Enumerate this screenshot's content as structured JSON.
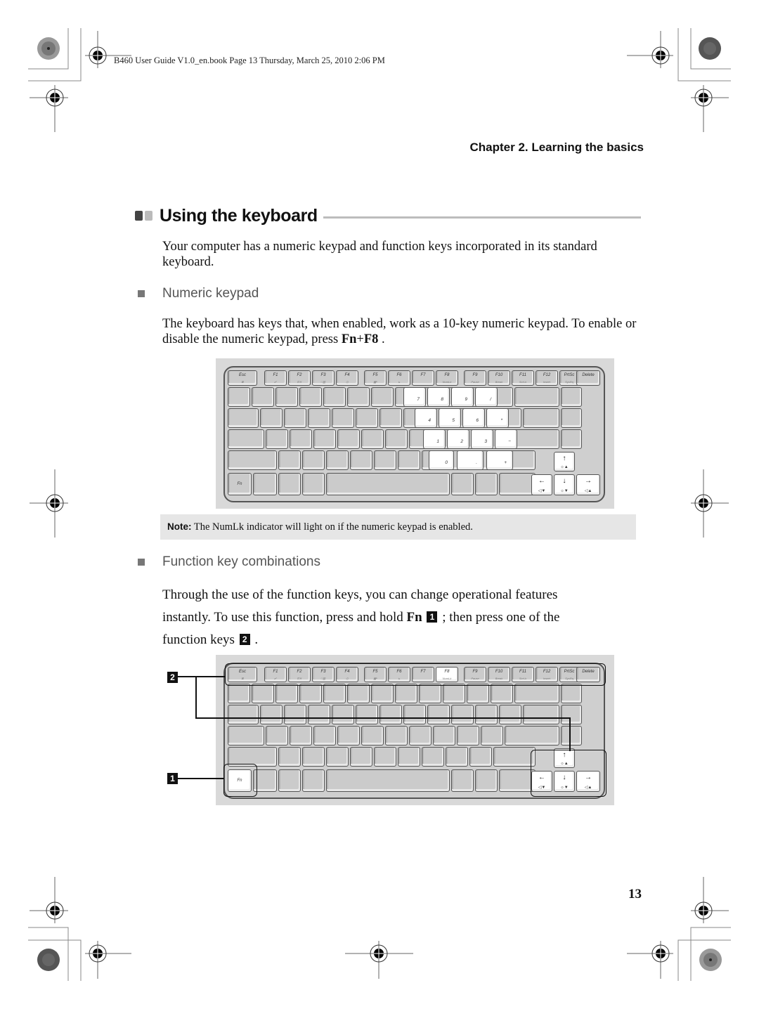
{
  "print_header": "B460 User Guide V1.0_en.book  Page 13  Thursday, March 25, 2010  2:06 PM",
  "chapter_title": "Chapter 2. Learning the basics",
  "section": {
    "title": "Using the keyboard",
    "intro": "Your computer has a numeric keypad and function keys incorporated in its standard keyboard."
  },
  "numeric_keypad": {
    "heading": "Numeric keypad",
    "text_before": "The keyboard has keys that, when enabled, work as a 10-key numeric keypad. To enable or disable the numeric keypad, press ",
    "key_fn": "Fn",
    "plus": "+",
    "key_f8": "F8",
    "text_after": " ."
  },
  "note": {
    "label": "Note:",
    "text": " The NumLk indicator will light on if the numeric keypad is enabled."
  },
  "function_keys": {
    "heading": "Function key combinations",
    "line1": "Through the use of the function keys, you can change operational features",
    "line2_a": "instantly. To use this function, press and hold ",
    "key_fn": "Fn",
    "callout1": "1",
    "line2_b": " ; then press one of the",
    "line3_a": "function keys ",
    "callout2": "2",
    "line3_b": " ."
  },
  "keyboard": {
    "function_row": [
      {
        "label": "Esc",
        "sub": "⊠"
      },
      {
        "label": "F1",
        "sub": "zᶻ"
      },
      {
        "label": "F2",
        "sub": "⊡✕"
      },
      {
        "label": "F3",
        "sub": "□▥"
      },
      {
        "label": "F4",
        "sub": "⎙"
      },
      {
        "label": "F5",
        "sub": "▦ᵃ"
      },
      {
        "label": "F6",
        "sub": "⊾"
      },
      {
        "label": "F7",
        "sub": ""
      },
      {
        "label": "F8",
        "sub": "NumLk"
      },
      {
        "label": "F9",
        "sub": "Pause"
      },
      {
        "label": "F10",
        "sub": "Break"
      },
      {
        "label": "F11",
        "sub": "ScrLk"
      },
      {
        "label": "F12",
        "sub": "Insert"
      },
      {
        "label": "PrtSc",
        "sub": "SysRq"
      },
      {
        "label": "Delete",
        "sub": ""
      }
    ],
    "numpad_keys": [
      "7",
      "8",
      "9",
      "/",
      "4",
      "5",
      "6",
      "*",
      "1",
      "2",
      "3",
      "−",
      "0",
      ".",
      "+"
    ],
    "fn_label": "Fn",
    "arrows": {
      "up": {
        "glyph": "↑",
        "sub": "☼▲"
      },
      "left": {
        "glyph": "←",
        "sub": "◁▼"
      },
      "down": {
        "glyph": "↓",
        "sub": "☼▼"
      },
      "right": {
        "glyph": "→",
        "sub": "◁▲"
      }
    },
    "callouts": [
      "2",
      "1"
    ]
  },
  "page_number": "13"
}
